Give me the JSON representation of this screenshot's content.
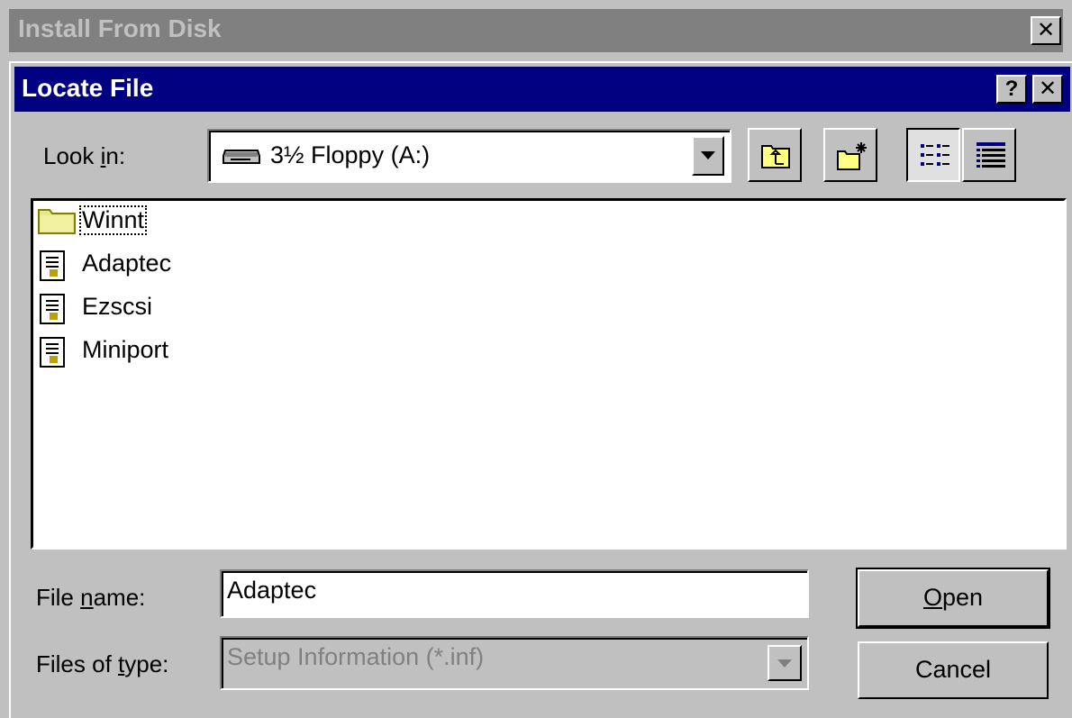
{
  "outer_window": {
    "title": "Install From Disk",
    "close_label": "✕"
  },
  "dialog": {
    "title": "Locate File",
    "help_label": "?",
    "close_label": "✕"
  },
  "look_in": {
    "label_pre": "Look ",
    "label_accel": "i",
    "label_post": "n:",
    "value": "3½ Floppy (A:)",
    "icon": "floppy-drive-icon"
  },
  "toolbar": {
    "buttons": [
      {
        "name": "up-one-level-button",
        "icon": "up-folder-icon"
      },
      {
        "name": "create-new-folder-button",
        "icon": "new-folder-icon"
      },
      {
        "name": "list-view-button",
        "icon": "list-view-icon",
        "pressed": true
      },
      {
        "name": "details-view-button",
        "icon": "details-view-icon",
        "pressed": false
      }
    ]
  },
  "files": [
    {
      "name": "Winnt",
      "type": "folder",
      "icon": "folder-icon",
      "focused": true
    },
    {
      "name": "Adaptec",
      "type": "setup-info",
      "icon": "setup-file-icon"
    },
    {
      "name": "Ezscsi",
      "type": "setup-info",
      "icon": "setup-file-icon"
    },
    {
      "name": "Miniport",
      "type": "setup-info",
      "icon": "setup-file-icon"
    }
  ],
  "file_name": {
    "label_pre": "File ",
    "label_accel": "n",
    "label_post": "ame:",
    "value": "Adaptec"
  },
  "files_of_type": {
    "label_pre": "Files of ",
    "label_accel": "t",
    "label_post": "ype:",
    "value": "Setup Information (*.inf)",
    "disabled": true
  },
  "buttons": {
    "open_accel": "O",
    "open_rest": "pen",
    "cancel": "Cancel"
  }
}
